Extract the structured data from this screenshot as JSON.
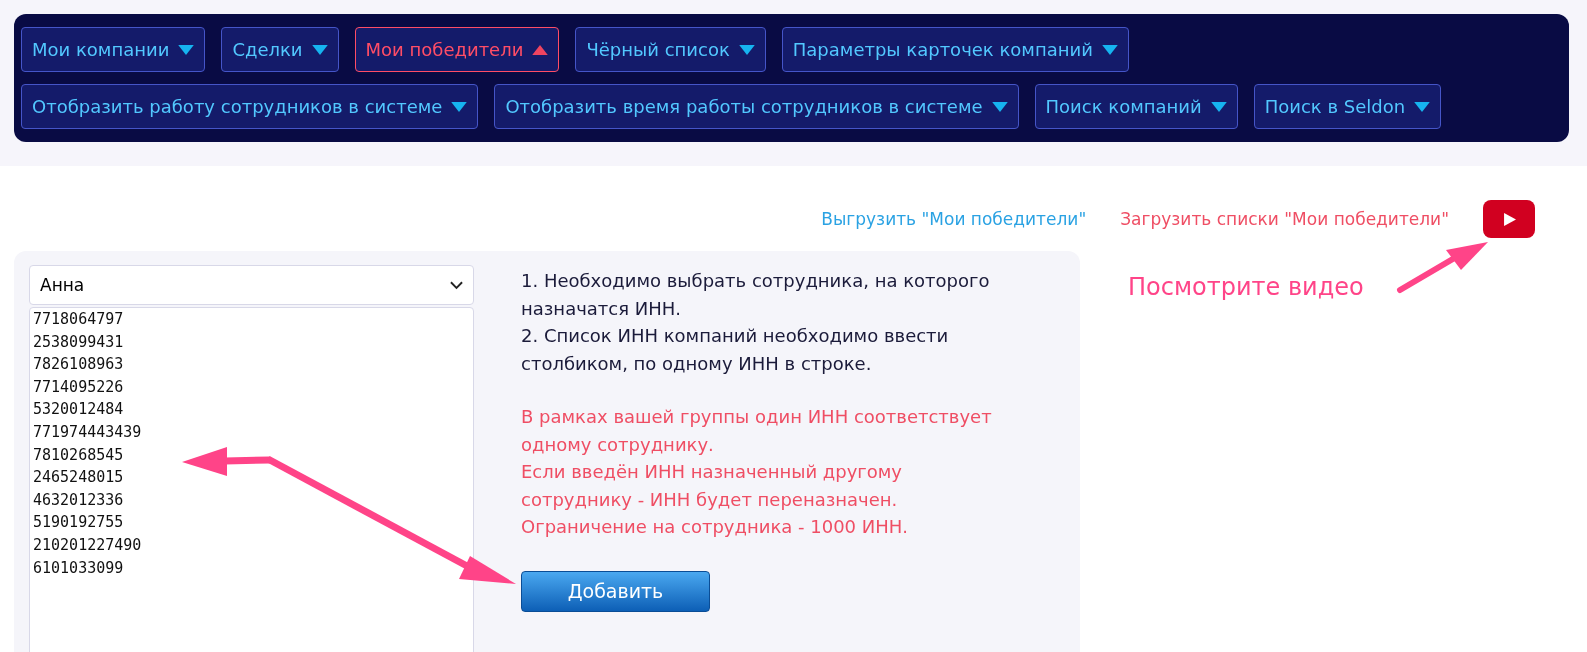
{
  "menu_rows": [
    [
      {
        "label": "Мои компании",
        "selected": false
      },
      {
        "label": "Сделки",
        "selected": false
      },
      {
        "label": "Мои победители",
        "selected": true
      },
      {
        "label": "Чёрный список",
        "selected": false
      },
      {
        "label": "Параметры карточек компаний",
        "selected": false
      }
    ],
    [
      {
        "label": "Отобразить работу сотрудников в системе",
        "selected": false
      },
      {
        "label": "Отобразить время работы сотрудников в системе",
        "selected": false
      },
      {
        "label": "Поиск компаний",
        "selected": false
      },
      {
        "label": "Поиск в Seldon",
        "selected": false
      }
    ]
  ],
  "links": [
    {
      "label": "Выгрузить \"Мои победители\"",
      "kind": "export"
    },
    {
      "label": "Загрузить списки \"Мои победители\"",
      "kind": "import"
    }
  ],
  "employee_select": {
    "value": "Анна"
  },
  "inn_field": {
    "value": [
      "7718064797",
      "2538099431",
      "7826108963",
      "7714095226",
      "5320012484",
      "771974443439",
      "7810268545",
      "2465248015",
      "4632012336",
      "5190192755",
      "210201227490",
      "6101033099"
    ]
  },
  "instructions": [
    "1. Необходимо выбрать сотрудника, на которого назначатся ИНН.",
    "2. Список ИНН компаний необходимо ввести столбиком, по одному ИНН в строке."
  ],
  "warnings": [
    "В рамках вашей группы один ИНН соответствует одному сотруднику.",
    "Если введён ИНН назначенный другому сотруднику - ИНН будет переназначен.",
    "Ограничение на сотрудника - 1000 ИНН."
  ],
  "add_button": "Добавить",
  "video_hint": "Посмотрите видео"
}
